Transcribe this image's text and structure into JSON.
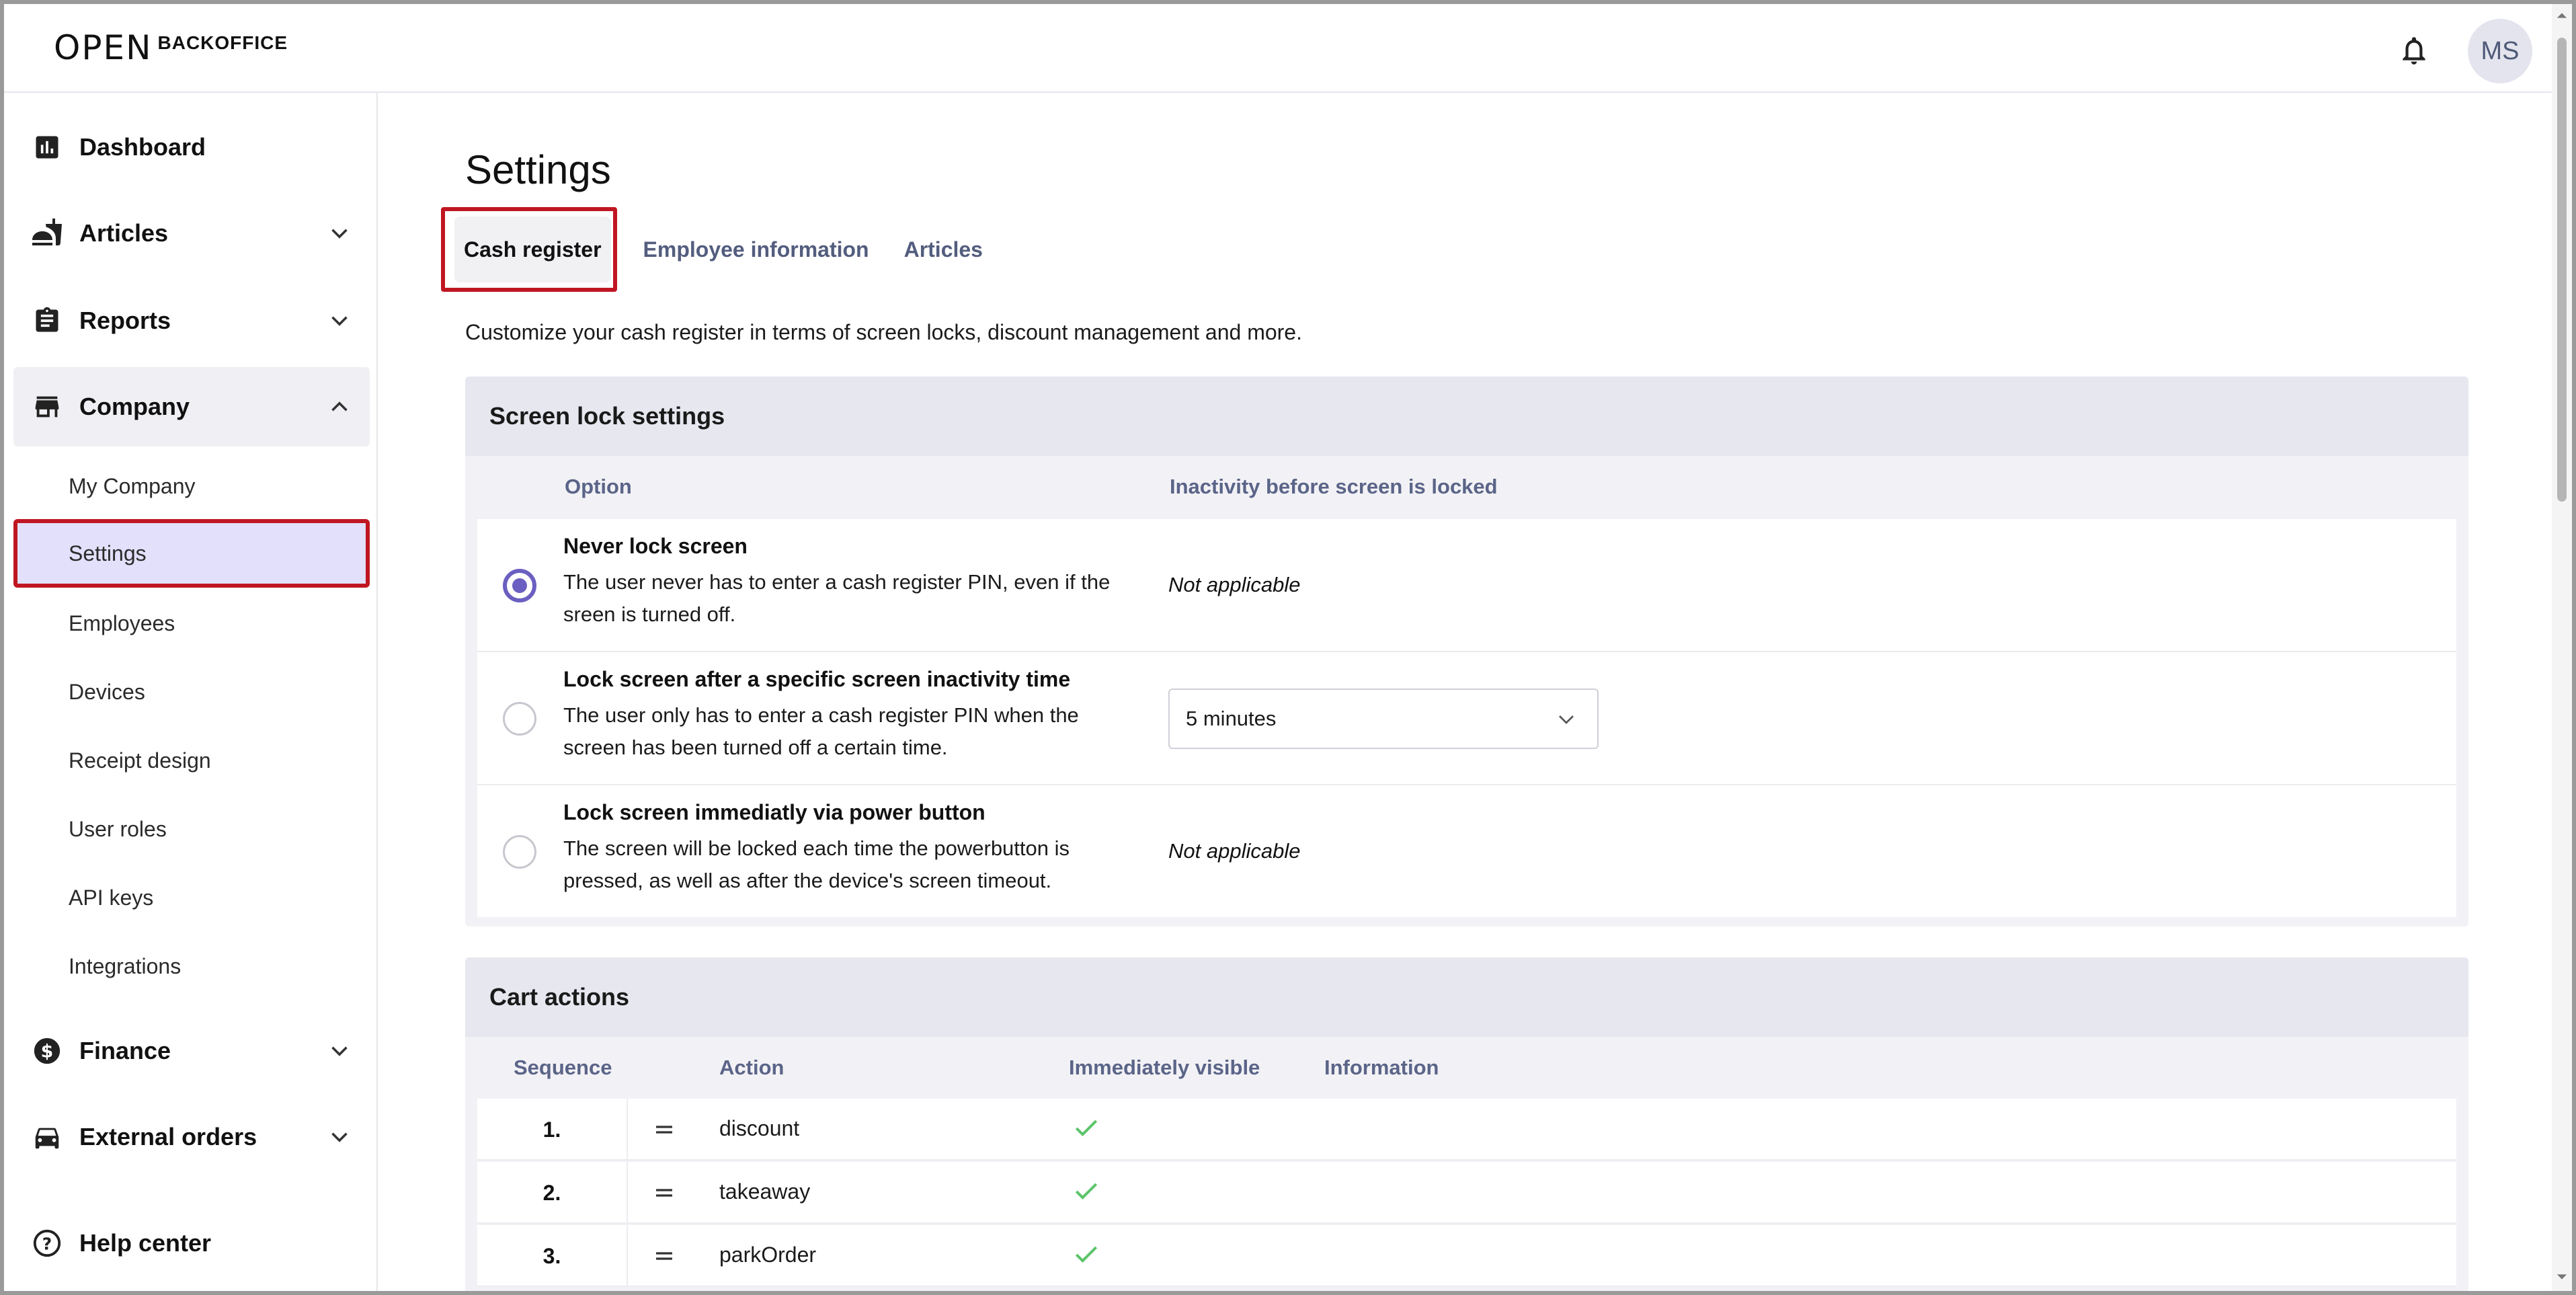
{
  "app": {
    "logo_mark": "OPEN",
    "logo_word": "BACKOFFICE",
    "avatar_initials": "MS"
  },
  "sidebar": {
    "dashboard": "Dashboard",
    "articles": "Articles",
    "reports": "Reports",
    "company": "Company",
    "company_items": [
      "My Company",
      "Settings",
      "Employees",
      "Devices",
      "Receipt design",
      "User roles",
      "API keys",
      "Integrations"
    ],
    "active_item": "Settings",
    "finance": "Finance",
    "external_orders": "External orders",
    "help_center": "Help center"
  },
  "page": {
    "title": "Settings",
    "tabs": [
      "Cash register",
      "Employee information",
      "Articles"
    ],
    "active_tab": "Cash register",
    "intro": "Customize your cash register in terms of screen locks, discount management and more."
  },
  "screen_lock": {
    "heading": "Screen lock settings",
    "col_option": "Option",
    "col_inactivity": "Inactivity before screen is locked",
    "options": [
      {
        "title": "Never lock screen",
        "desc": "The user never has to enter a cash register PIN, even if the sreen is turned off.",
        "value": "Not applicable",
        "selected": true
      },
      {
        "title": "Lock screen after a specific screen inactivity time",
        "desc": "The user only has to enter a cash register PIN when the screen has been turned off a certain time.",
        "value": "5 minutes",
        "selected": false
      },
      {
        "title": "Lock screen immediatly via power button",
        "desc": "The screen will be locked each time the powerbutton is pressed, as well as after the device's screen timeout.",
        "value": "Not applicable",
        "selected": false
      }
    ]
  },
  "cart_actions": {
    "heading": "Cart actions",
    "col_sequence": "Sequence",
    "col_action": "Action",
    "col_visible": "Immediately visible",
    "col_info": "Information",
    "rows": [
      {
        "seq": "1.",
        "action": "discount",
        "visible": true
      },
      {
        "seq": "2.",
        "action": "takeaway",
        "visible": true
      },
      {
        "seq": "3.",
        "action": "parkOrder",
        "visible": true
      }
    ]
  },
  "colors": {
    "accent": "#6b5fc1",
    "highlight": "#c01622",
    "check": "#5cc46a",
    "active_bg": "#e3e0fb"
  }
}
